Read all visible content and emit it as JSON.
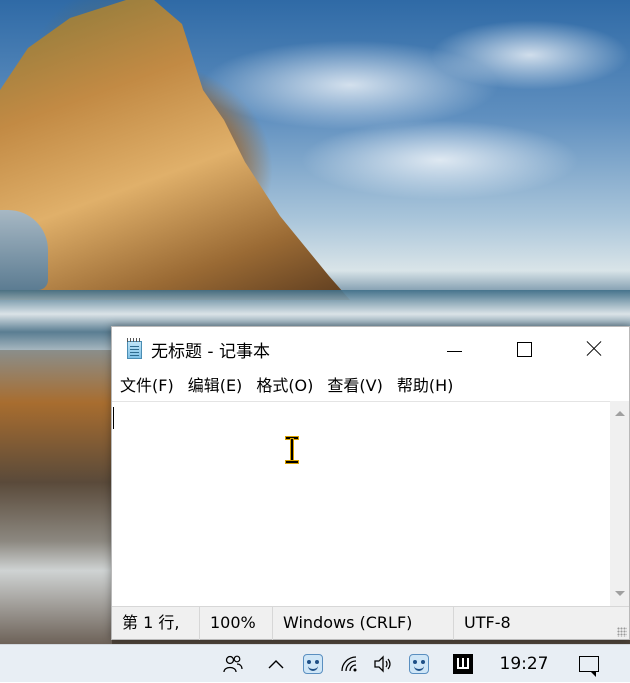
{
  "window": {
    "title": "无标题 - 记事本",
    "app_icon": "notepad-icon"
  },
  "menu": {
    "items": [
      "文件(F)",
      "编辑(E)",
      "格式(O)",
      "查看(V)",
      "帮助(H)"
    ]
  },
  "editor": {
    "content": ""
  },
  "status": {
    "position": "第 1 行,",
    "zoom": "100%",
    "line_ending": "Windows (CRLF)",
    "encoding": "UTF-8"
  },
  "taskbar": {
    "time": "19:27",
    "icons": [
      "people-icon",
      "chevron-up-icon",
      "tray-app-icon",
      "wifi-icon",
      "volume-icon",
      "tray-app-icon",
      "ime-icon",
      "notification-icon"
    ]
  }
}
